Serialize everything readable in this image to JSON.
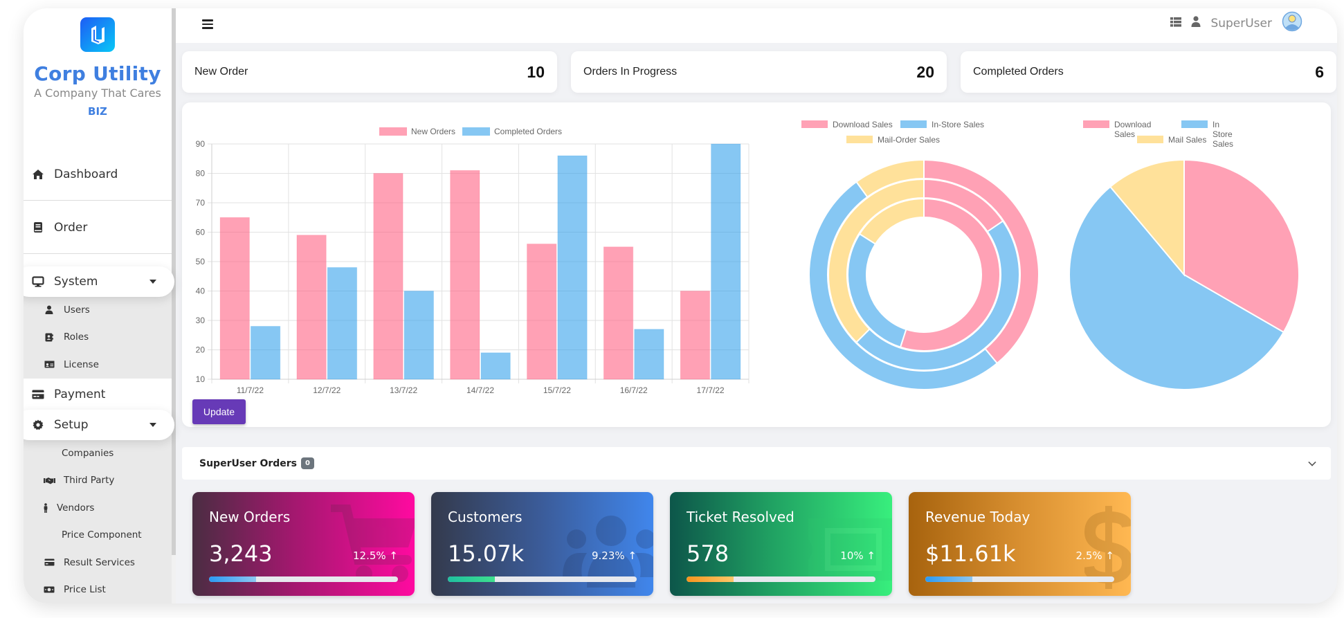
{
  "brand": {
    "title": "Corp Utility",
    "subtitle": "A Company That Cares",
    "tag": "BIZ"
  },
  "sidebar": {
    "items": [
      {
        "label": "Dashboard",
        "icon": "home-icon"
      },
      {
        "label": "Order",
        "icon": "book-icon"
      },
      {
        "label": "System",
        "icon": "monitor-icon",
        "expanded": true,
        "children": [
          {
            "label": "Users",
            "icon": "user-icon"
          },
          {
            "label": "Roles",
            "icon": "address-book-icon"
          },
          {
            "label": "License",
            "icon": "id-card-icon"
          }
        ]
      },
      {
        "label": "Payment",
        "icon": "credit-card-icon"
      },
      {
        "label": "Setup",
        "icon": "gear-icon",
        "expanded": true,
        "children": [
          {
            "label": "Companies",
            "icon": ""
          },
          {
            "label": "Third Party",
            "icon": "handshake-icon"
          },
          {
            "label": "Vendors",
            "icon": "person-icon"
          },
          {
            "label": "Price Component",
            "icon": ""
          },
          {
            "label": "Result Services",
            "icon": "credit-card-icon"
          },
          {
            "label": "Price List",
            "icon": "money-bill-icon"
          }
        ]
      }
    ]
  },
  "topbar": {
    "menu_icon": "hamburger-icon",
    "list_icon": "list-icon",
    "user_icon": "user-icon",
    "username": "SuperUser",
    "avatar_icon": "avatar-icon"
  },
  "stats": [
    {
      "label": "New Order",
      "value": "10"
    },
    {
      "label": "Orders In Progress",
      "value": "20"
    },
    {
      "label": "Completed Orders",
      "value": "6"
    }
  ],
  "update_button": "Update",
  "orders_section": {
    "title": "SuperUser Orders",
    "badge": "0"
  },
  "kpis": [
    {
      "title": "New Orders",
      "value": "3,243",
      "change": "12.5%",
      "trend": "up",
      "progress": 0.25,
      "bg_icon": "cart-icon"
    },
    {
      "title": "Customers",
      "value": "15.07k",
      "change": "9.23%",
      "trend": "up",
      "progress": 0.25,
      "bg_icon": "users-icon"
    },
    {
      "title": "Ticket Resolved",
      "value": "578",
      "change": "10%",
      "trend": "up",
      "progress": 0.25,
      "bg_icon": "ticket-icon"
    },
    {
      "title": "Revenue Today",
      "value": "$11.61k",
      "change": "2.5%",
      "trend": "up",
      "progress": 0.25,
      "bg_icon": "dollar-icon"
    }
  ],
  "colors": {
    "pink": "#ff6384",
    "blue": "#36a2eb",
    "yellow": "#ffcd56",
    "brand_blue": "#3f7fe0",
    "update_purple": "#673ab7"
  },
  "chart_data": [
    {
      "type": "bar",
      "title": "",
      "categories": [
        "11/7/22",
        "12/7/22",
        "13/7/22",
        "14/7/22",
        "15/7/22",
        "16/7/22",
        "17/7/22"
      ],
      "series": [
        {
          "name": "New Orders",
          "color": "#ff6384",
          "values": [
            65,
            59,
            80,
            81,
            56,
            55,
            40
          ]
        },
        {
          "name": "Completed Orders",
          "color": "#36a2eb",
          "values": [
            28,
            48,
            40,
            19,
            86,
            27,
            90
          ]
        }
      ],
      "yticks": [
        10,
        20,
        30,
        40,
        50,
        60,
        70,
        80,
        90
      ],
      "ylim": [
        10,
        90
      ],
      "grid": true,
      "legend": "top"
    },
    {
      "type": "doughnut",
      "title": "",
      "labels": [
        "Download Sales",
        "In-Store Sales",
        "Mail-Order Sales"
      ],
      "colors": [
        "#ff6384",
        "#36a2eb",
        "#ffcd56"
      ],
      "rings": [
        {
          "name": "outer",
          "values": [
            39,
            51,
            10
          ]
        },
        {
          "name": "middle",
          "values": [
            15.5,
            47,
            37.5
          ]
        },
        {
          "name": "inner",
          "values": [
            55,
            29,
            16
          ]
        }
      ],
      "legend": "top"
    },
    {
      "type": "pie",
      "title": "",
      "labels": [
        "Download Sales",
        "In Store Sales",
        "Mail Sales"
      ],
      "colors": [
        "#ff6384",
        "#36a2eb",
        "#ffcd56"
      ],
      "values": [
        300,
        500,
        100
      ],
      "legend": "top"
    }
  ]
}
